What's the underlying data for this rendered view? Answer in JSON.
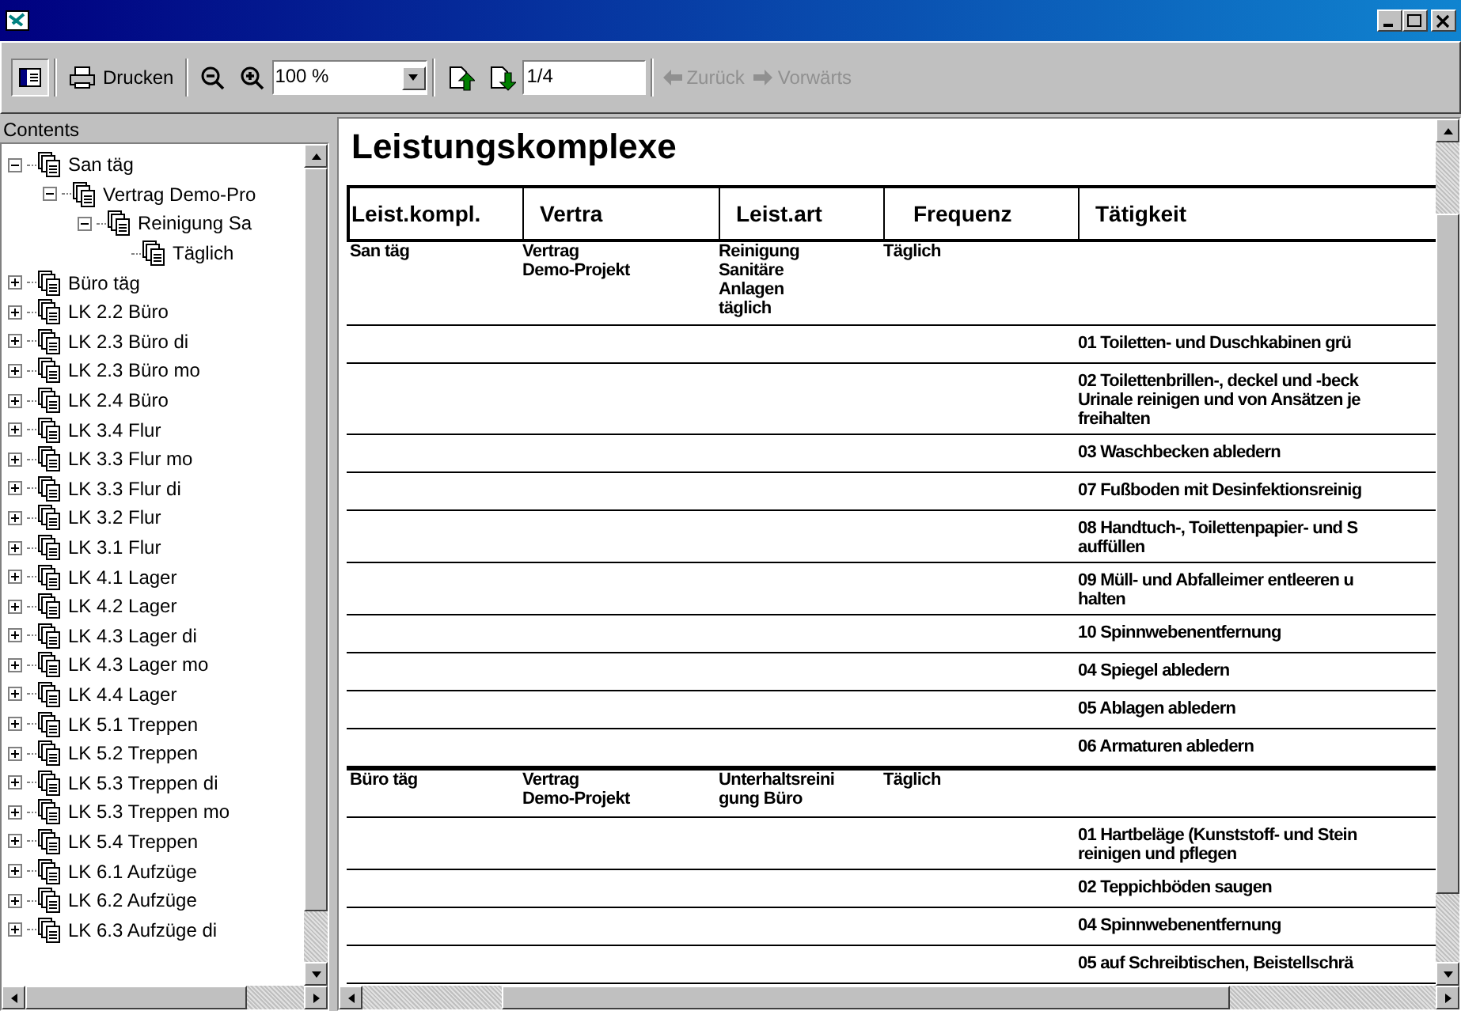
{
  "toolbar": {
    "contents_pressed": true,
    "print_label": "Drucken",
    "zoom": "100 %",
    "page": "1/4",
    "back": {
      "label": "Zurück",
      "disabled": true
    },
    "forward": {
      "label": "Vorwärts",
      "disabled": true
    }
  },
  "contents": {
    "title": "Contents",
    "items": [
      {
        "label": "San täg",
        "expanded": true,
        "children": [
          {
            "label": "Vertrag Demo-Pro",
            "expanded": true,
            "children": [
              {
                "label": "Reinigung Sa",
                "expanded": true,
                "children": [
                  {
                    "label": "Täglich"
                  }
                ]
              }
            ]
          }
        ]
      },
      {
        "label": "Büro täg",
        "expanded": false
      },
      {
        "label": "LK 2.2 Büro",
        "expanded": false
      },
      {
        "label": "LK 2.3 Büro di",
        "expanded": false
      },
      {
        "label": "LK 2.3 Büro mo",
        "expanded": false
      },
      {
        "label": "LK 2.4 Büro",
        "expanded": false
      },
      {
        "label": "LK 3.4 Flur",
        "expanded": false
      },
      {
        "label": "LK 3.3 Flur mo",
        "expanded": false
      },
      {
        "label": "LK 3.3 Flur di",
        "expanded": false
      },
      {
        "label": "LK 3.2 Flur",
        "expanded": false
      },
      {
        "label": "LK 3.1 Flur",
        "expanded": false
      },
      {
        "label": "LK 4.1 Lager",
        "expanded": false
      },
      {
        "label": "LK 4.2 Lager",
        "expanded": false
      },
      {
        "label": "LK 4.3 Lager di",
        "expanded": false
      },
      {
        "label": "LK 4.3 Lager mo",
        "expanded": false
      },
      {
        "label": "LK 4.4 Lager",
        "expanded": false
      },
      {
        "label": "LK 5.1 Treppen",
        "expanded": false
      },
      {
        "label": "LK 5.2 Treppen",
        "expanded": false
      },
      {
        "label": "LK 5.3 Treppen di",
        "expanded": false
      },
      {
        "label": "LK 5.3 Treppen mo",
        "expanded": false
      },
      {
        "label": "LK 5.4 Treppen",
        "expanded": false
      },
      {
        "label": "LK 6.1 Aufzüge",
        "expanded": false
      },
      {
        "label": "LK 6.2 Aufzüge",
        "expanded": false
      },
      {
        "label": "LK 6.3 Aufzüge di",
        "expanded": false
      }
    ]
  },
  "report": {
    "title": "Leistungskomplexe",
    "columns": [
      "Leist.kompl.",
      "Vertra",
      "Leist.art",
      "Frequenz",
      "Tätigkeit"
    ],
    "groups": [
      {
        "cells": [
          "San täg",
          "Vertrag\nDemo-Projekt",
          "Reinigung\nSanitäre\nAnlagen\ntäglich",
          "Täglich"
        ],
        "activities": [
          "01 Toiletten- und Duschkabinen grü",
          "02 Toilettenbrillen-, deckel und -beck\nUrinale reinigen und von Ansätzen je\nfreihalten",
          "03 Waschbecken abledern",
          "07 Fußboden mit Desinfektionsreinig",
          "08 Handtuch-, Toilettenpapier- und S\nauffüllen",
          "09 Müll- und Abfalleimer entleeren u\nhalten",
          "10 Spinnwebenentfernung",
          "04 Spiegel abledern",
          "05 Ablagen abledern",
          "06 Armaturen abledern"
        ]
      },
      {
        "cells": [
          "Büro täg",
          "Vertrag\nDemo-Projekt",
          "Unterhaltsreini\ngung Büro",
          "Täglich"
        ],
        "activities": [
          "01 Hartbeläge (Kunststoff- und Stein\nreinigen und pflegen",
          "02 Teppichböden saugen",
          "04 Spinnwebenentfernung",
          "05 auf Schreibtischen, Beistellschrä"
        ]
      }
    ]
  }
}
